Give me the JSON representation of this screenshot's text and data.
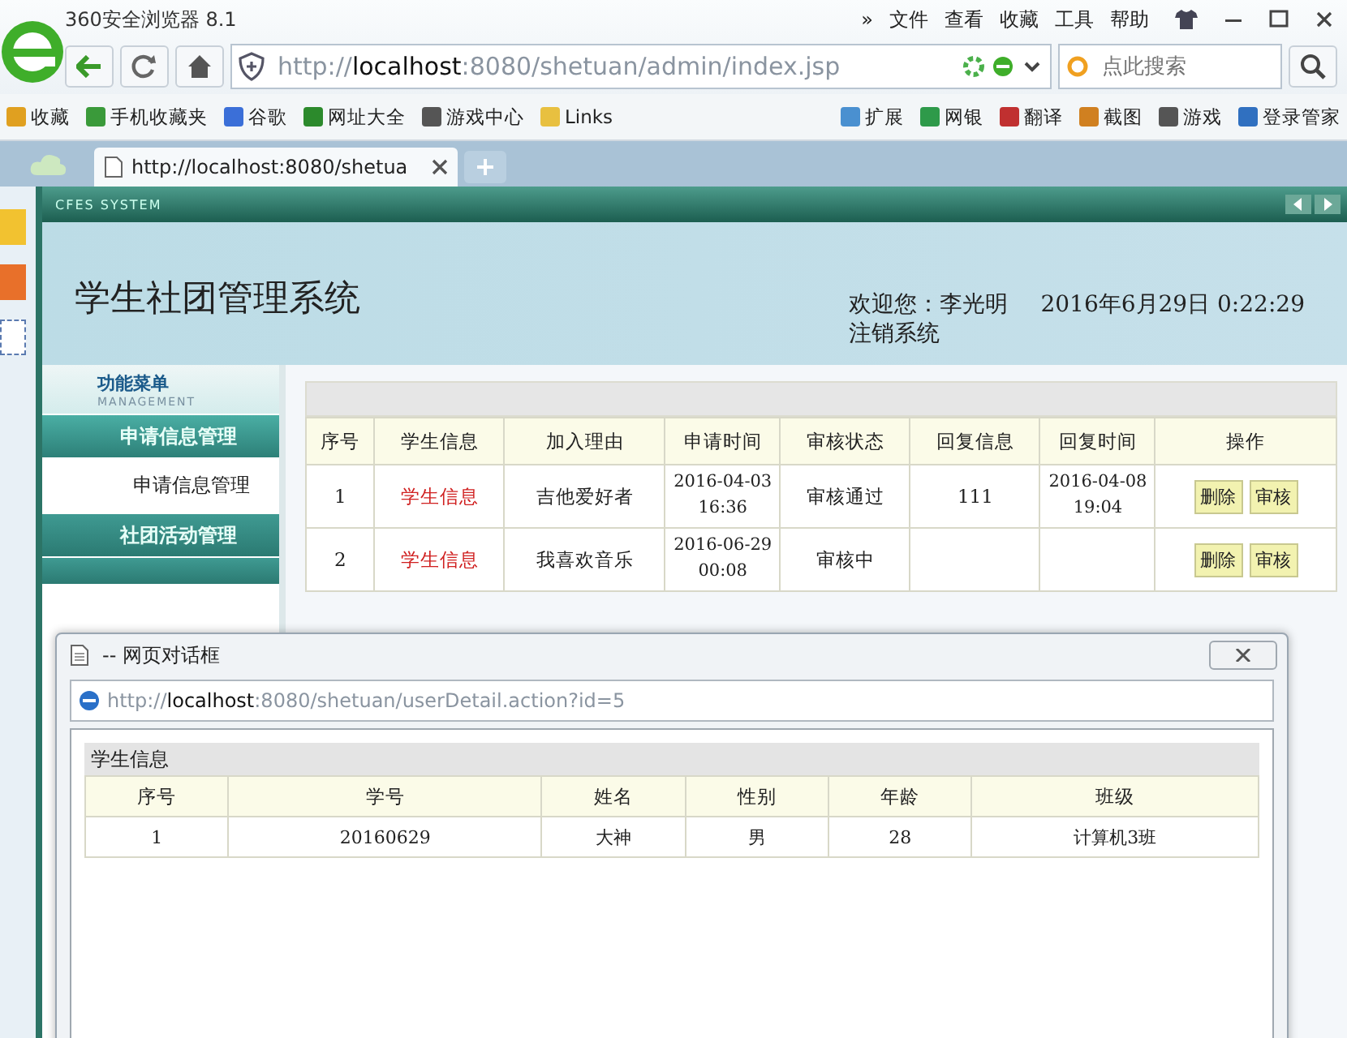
{
  "browser": {
    "title": "360安全浏览器 8.1",
    "menu": [
      "»",
      "文件",
      "查看",
      "收藏",
      "工具",
      "帮助"
    ],
    "address": "http://localhost:8080/shetuan/admin/index.jsp",
    "search_placeholder": "点此搜索",
    "bookmarks": [
      {
        "label": "收藏",
        "kind": "menu"
      },
      {
        "label": "手机收藏夹",
        "kind": "phone"
      },
      {
        "label": "谷歌",
        "kind": "google"
      },
      {
        "label": "网址大全",
        "kind": "plus"
      },
      {
        "label": "游戏中心",
        "kind": "game"
      },
      {
        "label": "Links",
        "kind": "folder"
      }
    ],
    "tools": [
      {
        "label": "扩展",
        "kind": "grid"
      },
      {
        "label": "网银",
        "kind": "shield"
      },
      {
        "label": "翻译",
        "kind": "translate"
      },
      {
        "label": "截图",
        "kind": "scissors"
      },
      {
        "label": "游戏",
        "kind": "game"
      },
      {
        "label": "登录管家",
        "kind": "key"
      }
    ],
    "tabs": [
      {
        "label": "http://localhost:8080/shetua",
        "selected": true
      }
    ]
  },
  "app": {
    "system_label": "CFES SYSTEM",
    "title": "学生社团管理系统",
    "welcome": "欢迎您：李光明",
    "datetime": "2016年6月29日  0:22:29",
    "logout": "注销系统",
    "menu_title": "功能菜单",
    "menu_subtitle": "MANAGEMENT",
    "menu": [
      {
        "label": "申请信息管理",
        "expanded": true,
        "children": [
          {
            "label": "申请信息管理"
          }
        ]
      },
      {
        "label": "社团活动管理",
        "expanded": false
      }
    ],
    "table": {
      "columns": [
        "序号",
        "学生信息",
        "加入理由",
        "申请时间",
        "审核状态",
        "回复信息",
        "回复时间",
        "操作"
      ],
      "rows": [
        {
          "cells": [
            "1",
            "学生信息",
            "吉他爱好者",
            "2016-04-03 16:36",
            "审核通过",
            "111",
            "2016-04-08 19:04"
          ],
          "actions": [
            "删除",
            "审核"
          ]
        },
        {
          "cells": [
            "2",
            "学生信息",
            "我喜欢音乐",
            "2016-06-29 00:08",
            "审核中",
            "",
            ""
          ],
          "actions": [
            "删除",
            "审核"
          ]
        }
      ]
    }
  },
  "dialog": {
    "title": "-- 网页对话框",
    "address": "http://localhost:8080/shetuan/userDetail.action?id=5",
    "caption": "学生信息",
    "columns": [
      "序号",
      "学号",
      "姓名",
      "性别",
      "年龄",
      "班级"
    ],
    "rows": [
      [
        "1",
        "20160629",
        "大神",
        "男",
        "28",
        "计算机3班"
      ]
    ]
  }
}
